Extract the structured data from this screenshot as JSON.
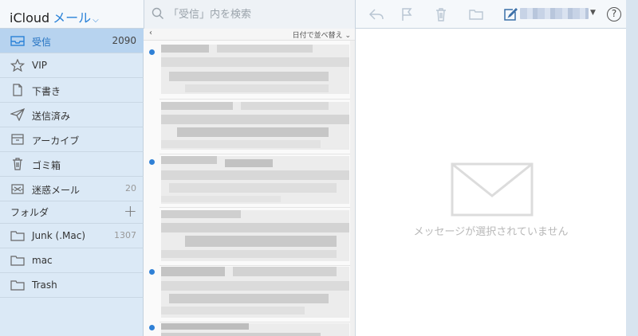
{
  "header": {
    "brand": "iCloud",
    "app": "メール",
    "search_placeholder": "「受信」内を検索",
    "help": "?"
  },
  "sidebar": {
    "mailboxes": [
      {
        "label": "受信",
        "count": "2090",
        "icon": "inbox-icon",
        "active": true
      },
      {
        "label": "VIP",
        "count": "",
        "icon": "star-icon"
      },
      {
        "label": "下書き",
        "count": "",
        "icon": "document-icon"
      },
      {
        "label": "送信済み",
        "count": "",
        "icon": "paper-plane-icon"
      },
      {
        "label": "アーカイブ",
        "count": "",
        "icon": "archive-box-icon"
      },
      {
        "label": "ゴミ箱",
        "count": "",
        "icon": "trash-icon"
      },
      {
        "label": "迷惑メール",
        "count": "20",
        "icon": "junk-box-icon"
      }
    ],
    "folders_label": "フォルダ",
    "folders": [
      {
        "label": "Junk (.Mac)",
        "count": "1307",
        "icon": "folder-icon"
      },
      {
        "label": "mac",
        "count": "",
        "icon": "folder-icon"
      },
      {
        "label": "Trash",
        "count": "",
        "icon": "folder-icon"
      }
    ]
  },
  "list": {
    "sort_label": "日付で並べ替え"
  },
  "reading": {
    "empty_message": "メッセージが選択されていません"
  },
  "colors": {
    "accent": "#2a82d8",
    "sidebar_bg": "#dbe9f6",
    "active_bg": "#b7d3ef",
    "unread_dot": "#2f80d6"
  }
}
